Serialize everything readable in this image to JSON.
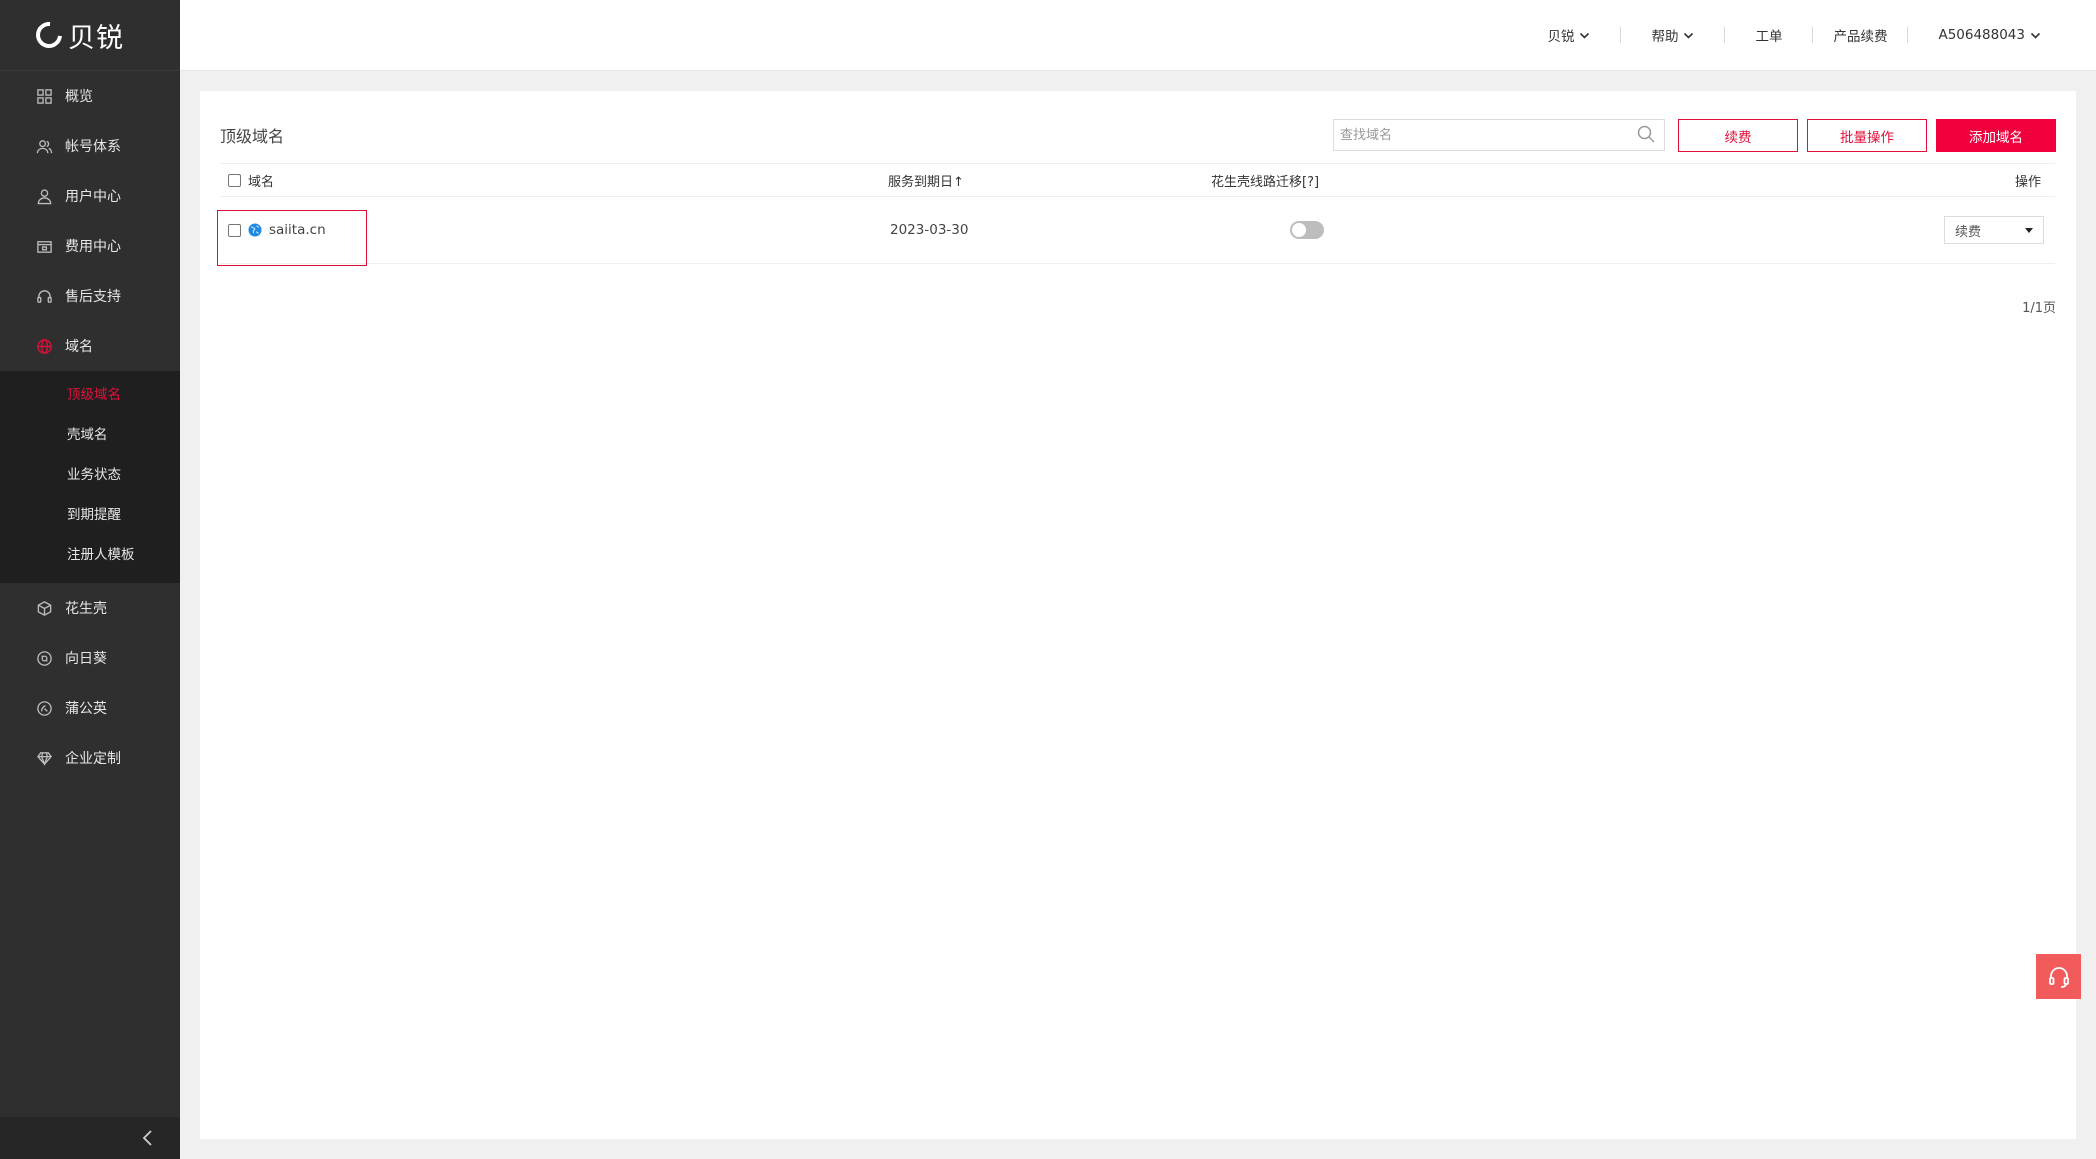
{
  "brand": {
    "name": "贝锐"
  },
  "sidebar": {
    "items": [
      {
        "label": "概览",
        "icon": "dashboard-icon"
      },
      {
        "label": "帐号体系",
        "icon": "users-icon"
      },
      {
        "label": "用户中心",
        "icon": "user-icon"
      },
      {
        "label": "费用中心",
        "icon": "wallet-icon"
      },
      {
        "label": "售后支持",
        "icon": "headset-icon"
      },
      {
        "label": "域名",
        "icon": "globe-icon",
        "active": true
      },
      {
        "label": "花生壳",
        "icon": "cube-icon"
      },
      {
        "label": "向日葵",
        "icon": "sunflower-icon"
      },
      {
        "label": "蒲公英",
        "icon": "dandelion-icon"
      },
      {
        "label": "企业定制",
        "icon": "diamond-icon"
      }
    ],
    "domain_sub": [
      {
        "label": "顶级域名",
        "active": true
      },
      {
        "label": "壳域名"
      },
      {
        "label": "业务状态"
      },
      {
        "label": "到期提醒"
      },
      {
        "label": "注册人模板"
      }
    ]
  },
  "header": {
    "links": [
      {
        "label": "贝锐",
        "dropdown": true
      },
      {
        "label": "帮助",
        "dropdown": true
      },
      {
        "label": "工单",
        "dropdown": false
      },
      {
        "label": "产品续费",
        "dropdown": false
      },
      {
        "label": "A506488043",
        "dropdown": true
      }
    ]
  },
  "main": {
    "title": "顶级域名",
    "search": {
      "placeholder": "查找域名",
      "value": ""
    },
    "buttons": {
      "renew": "续费",
      "batch": "批量操作",
      "add": "添加域名"
    },
    "table": {
      "headers": {
        "domain": "域名",
        "expiry": "服务到期日↑",
        "migration": "花生壳线路迁移[?]",
        "action": "操作"
      },
      "rows": [
        {
          "domain": "saiita.cn",
          "expiry": "2023-03-30",
          "migration_enabled": false,
          "action": "续费"
        }
      ]
    },
    "pager": "1/1页"
  },
  "colors": {
    "accent": "#e0103a",
    "sidebar_bg": "#2f2f2f",
    "submenu_bg": "#1f1f1f",
    "support_button": "#f25b5b"
  }
}
